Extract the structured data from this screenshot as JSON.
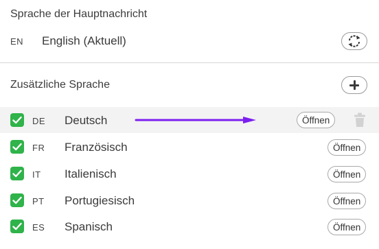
{
  "main_language": {
    "title": "Sprache der Hauptnachricht",
    "code": "EN",
    "name": "English (Aktuell)",
    "swap_icon": "refresh-icon"
  },
  "additional": {
    "title": "Zusätzliche Sprache",
    "add_icon": "plus-icon"
  },
  "languages": [
    {
      "code": "DE",
      "name": "Deutsch",
      "checked": true,
      "open_label": "Öffnen"
    },
    {
      "code": "FR",
      "name": "Französisch",
      "checked": true,
      "open_label": "Öffnen"
    },
    {
      "code": "IT",
      "name": "Italienisch",
      "checked": true,
      "open_label": "Öffnen"
    },
    {
      "code": "PT",
      "name": "Portugiesisch",
      "checked": true,
      "open_label": "Öffnen"
    },
    {
      "code": "ES",
      "name": "Spanisch",
      "checked": true,
      "open_label": "Öffnen"
    }
  ],
  "colors": {
    "checkbox": "#2fb34a",
    "arrow": "#7b1ff0",
    "row_highlight": "#f3f3f3"
  }
}
